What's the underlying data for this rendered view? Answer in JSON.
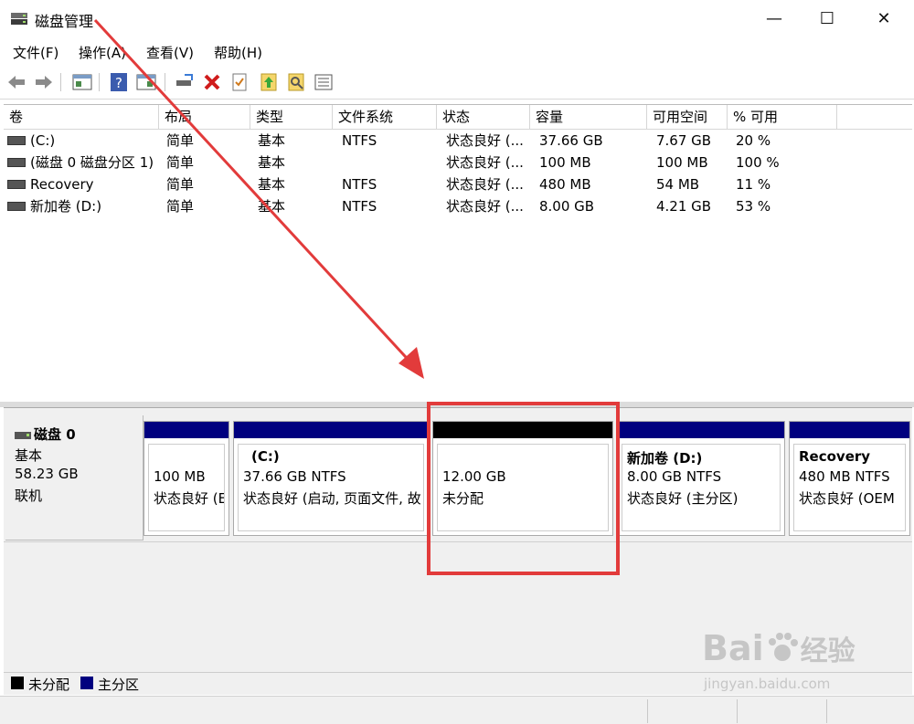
{
  "window": {
    "title": "磁盘管理",
    "controls": {
      "minimize": "—",
      "maximize": "☐",
      "close": "✕"
    }
  },
  "menu": {
    "items": [
      "文件(F)",
      "操作(A)",
      "查看(V)",
      "帮助(H)"
    ]
  },
  "toolbar": {
    "icons": [
      "back-icon",
      "forward-icon",
      "properties-view-icon",
      "help-icon",
      "console-tree-icon",
      "connect-disk-icon",
      "delete-icon",
      "check-icon",
      "import-icon",
      "search-disk-icon",
      "list-view-icon"
    ]
  },
  "volumes": {
    "headers": [
      "卷",
      "布局",
      "类型",
      "文件系统",
      "状态",
      "容量",
      "可用空间",
      "% 可用"
    ],
    "rows": [
      [
        "(C:)",
        "简单",
        "基本",
        "NTFS",
        "状态良好 (...",
        "37.66 GB",
        "7.67 GB",
        "20 %"
      ],
      [
        "(磁盘 0 磁盘分区 1)",
        "简单",
        "基本",
        "",
        "状态良好 (...",
        "100 MB",
        "100 MB",
        "100 %"
      ],
      [
        "Recovery",
        "简单",
        "基本",
        "NTFS",
        "状态良好 (...",
        "480 MB",
        "54 MB",
        "11 %"
      ],
      [
        "新加卷 (D:)",
        "简单",
        "基本",
        "NTFS",
        "状态良好 (...",
        "8.00 GB",
        "4.21 GB",
        "53 %"
      ]
    ]
  },
  "disk": {
    "name": "磁盘 0",
    "type": "基本",
    "size": "58.23 GB",
    "state": "联机",
    "partitions": [
      {
        "title": "",
        "line1": "100 MB",
        "line2": "状态良好 (E",
        "color": "#00007f"
      },
      {
        "title": "(C:)",
        "line1": "37.66 GB NTFS",
        "line2": "状态良好 (启动, 页面文件, 故",
        "color": "#00007f"
      },
      {
        "title": "",
        "line1": "12.00 GB",
        "line2": "未分配",
        "color": "#000000"
      },
      {
        "title": "新加卷 (D:)",
        "line1": "8.00 GB NTFS",
        "line2": "状态良好 (主分区)",
        "color": "#00007f"
      },
      {
        "title": "Recovery",
        "line1": "480 MB NTFS",
        "line2": "状态良好 (OEM",
        "color": "#00007f"
      }
    ]
  },
  "legend": [
    {
      "label": "未分配",
      "color": "#000000"
    },
    {
      "label": "主分区",
      "color": "#00007f"
    }
  ],
  "annotation": {
    "color": "#e23b3b"
  },
  "watermark": {
    "brand": "Bai",
    "brand2": "经验",
    "url": "jingyan.baidu.com"
  }
}
